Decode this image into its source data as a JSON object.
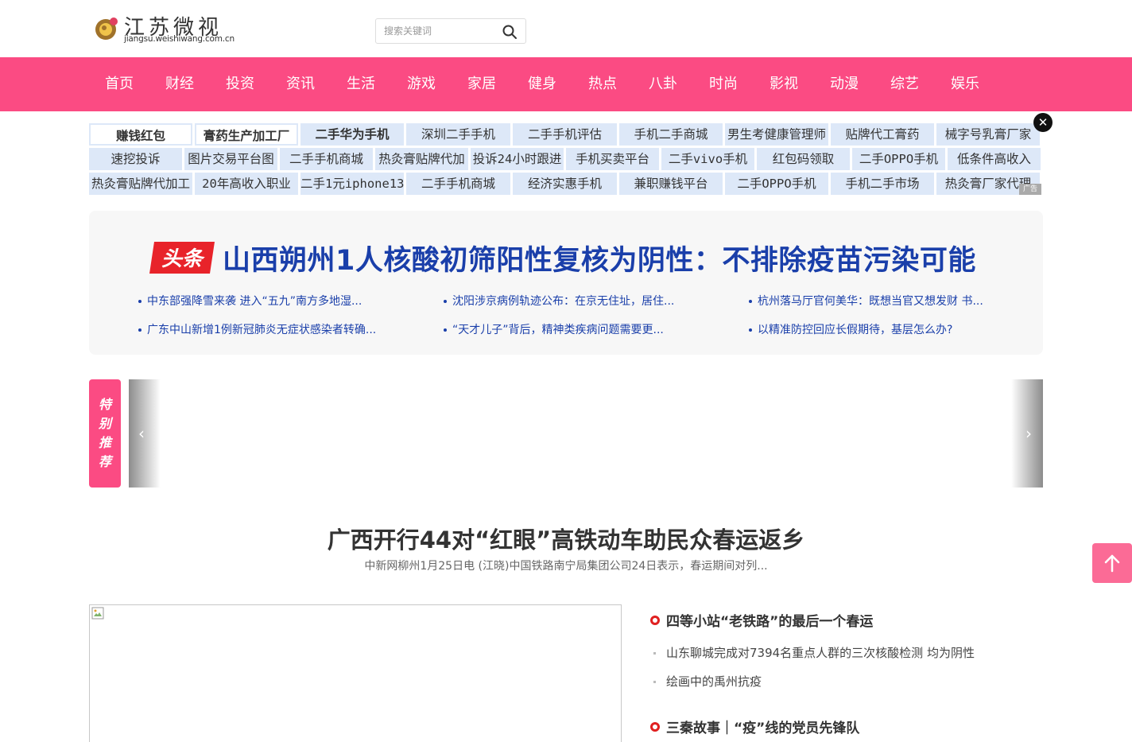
{
  "logo": {
    "name": "江苏微视",
    "domain": "jiangsu.weishiwang.com.cn"
  },
  "search": {
    "placeholder": "搜索关键词"
  },
  "nav": [
    "首页",
    "财经",
    "投资",
    "资讯",
    "生活",
    "游戏",
    "家居",
    "健身",
    "热点",
    "八卦",
    "时尚",
    "影视",
    "动漫",
    "综艺",
    "娱乐"
  ],
  "links": [
    [
      "赚钱红包",
      "膏药生产加工厂",
      "二手华为手机",
      "深圳二手手机",
      "二手手机评估",
      "手机二手商城",
      "男生考健康管理师",
      "贴牌代工膏药",
      "械字号乳膏厂家"
    ],
    [
      "速挖投诉",
      "图片交易平台图",
      "二手手机商城",
      "热灸膏贴牌代加",
      "投诉24小时跟进",
      "手机买卖平台",
      "二手vivo手机",
      "红包码领取",
      "二手OPPO手机",
      "低条件高收入"
    ],
    [
      "热灸膏贴牌代加工",
      "20年高收入职业",
      "二手1元iphone13",
      "二手手机商城",
      "经济实惠手机",
      "兼职赚钱平台",
      "二手OPPO手机",
      "手机二手市场",
      "热灸膏厂家代理"
    ]
  ],
  "close_label": "✕",
  "ad_label": "广告",
  "headline": {
    "badge": "头条",
    "title": "山西朔州1人核酸初筛阳性复核为阴性：不排除疫苗污染可能",
    "subs": [
      "中东部强降雪来袭 进入“五九”南方多地湿...",
      "沈阳涉京病例轨迹公布：在京无住址，居住...",
      "杭州落马厅官何美华：既想当官又想发财 书...",
      "广东中山新增1例新冠肺炎无症状感染者转确...",
      "“天才儿子”背后，精神类疾病问题需要更...",
      "以精准防控回应长假期待，基层怎么办?"
    ]
  },
  "carousel": {
    "tag": [
      "特",
      "别",
      "推",
      "荐"
    ],
    "prev": "‹",
    "next": "›"
  },
  "main_story": {
    "title": "广西开行44对“红眼”高铁动车助民众春运返乡",
    "summary": "中新网柳州1月25日电 (江晓)中国铁路南宁局集团公司24日表示，春运期间对列..."
  },
  "side_news": {
    "groups": [
      {
        "title": "四等小站“老铁路”的最后一个春运",
        "items": [
          "山东聊城完成对7394名重点人群的三次核酸检测 均为阴性",
          "绘画中的禹州抗疫"
        ]
      },
      {
        "title": "三秦故事｜“疫”线的党员先锋队",
        "items": []
      }
    ]
  },
  "colors": {
    "brand": "#fb4b83",
    "headline": "#1a3faa",
    "link_bg": "#dde8f8",
    "bullet": "#e02020"
  }
}
